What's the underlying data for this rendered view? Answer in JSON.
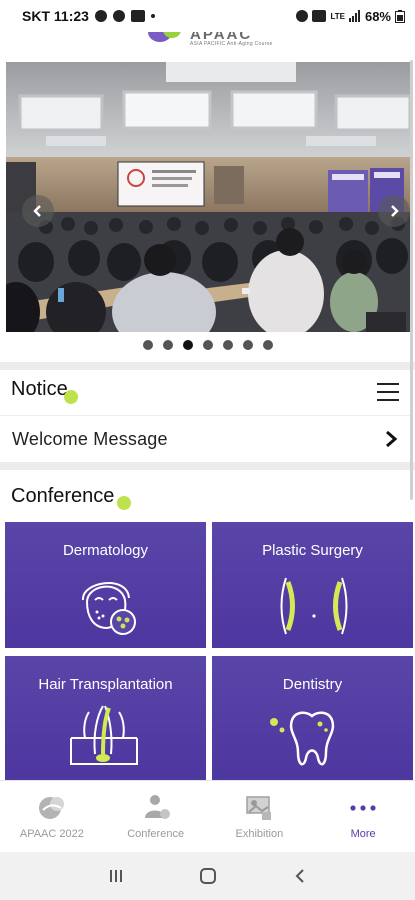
{
  "status_bar": {
    "carrier_time": "SKT 11:23",
    "network": "LTE",
    "battery": "68%"
  },
  "logo": {
    "brand_text": "APAAC",
    "tagline": "ASIA PACIFIC Anti-Aging Course"
  },
  "banner": {
    "slide_count": 7,
    "active_slide": 3
  },
  "notice": {
    "title": "Notice",
    "items": [
      {
        "label": "Welcome Message"
      }
    ]
  },
  "conference": {
    "title": "Conference",
    "tiles": [
      {
        "label": "Dermatology",
        "icon": "face-mask-icon"
      },
      {
        "label": "Plastic Surgery",
        "icon": "implant-icon"
      },
      {
        "label": "Hair Transplantation",
        "icon": "hair-follicle-icon"
      },
      {
        "label": "Dentistry",
        "icon": "tooth-icon"
      }
    ]
  },
  "bottom_nav": [
    {
      "label": "APAAC 2022",
      "icon": "apaac-logo-icon",
      "active": false
    },
    {
      "label": "Conference",
      "icon": "conference-icon",
      "active": false
    },
    {
      "label": "Exhibition",
      "icon": "exhibition-icon",
      "active": false
    },
    {
      "label": "More",
      "icon": "more-dots-icon",
      "active": true
    }
  ],
  "colors": {
    "tile_purple": "#4f39a2",
    "accent_green": "#b6df3a",
    "more_purple": "#5a3ea8"
  }
}
